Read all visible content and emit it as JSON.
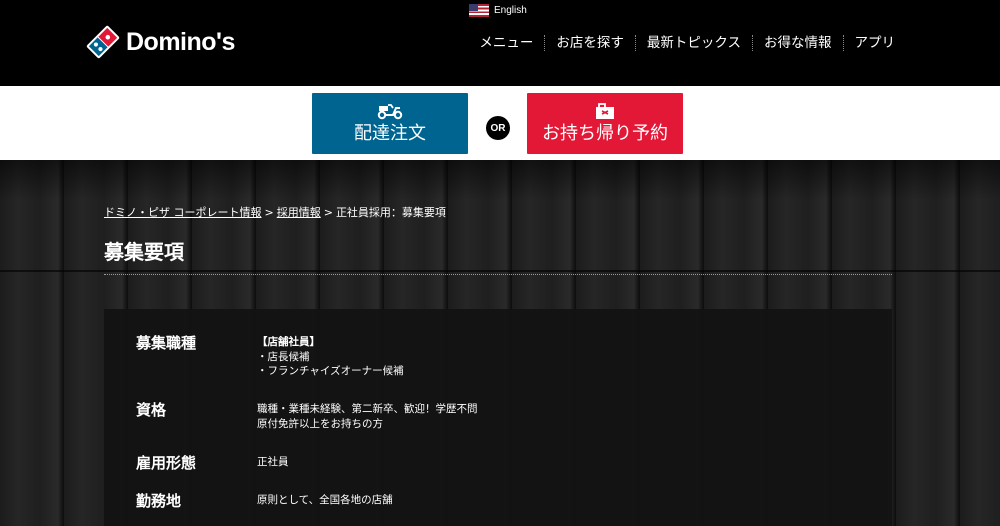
{
  "header": {
    "language": "English",
    "logo_text": "Domino's",
    "nav": [
      "メニュー",
      "お店を探す",
      "最新トピックス",
      "お得な情報",
      "アプリ"
    ]
  },
  "order": {
    "delivery_label": "配達注文",
    "or_label": "OR",
    "carryout_label": "お持ち帰り予約"
  },
  "breadcrumb": {
    "item1": "ドミノ・ピザ コーポレート情報",
    "item2": "採用情報",
    "current": "正社員採用：募集要項",
    "separator": ">"
  },
  "page": {
    "title": "募集要項"
  },
  "details": {
    "rows": [
      {
        "label": "募集職種",
        "lines": [
          "【店舗社員】",
          "・店長候補",
          "・フランチャイズオーナー候補"
        ]
      },
      {
        "label": "資格",
        "lines": [
          "職種・業種未経験、第二新卒、歓迎！学歴不問",
          "原付免許以上をお持ちの方"
        ]
      },
      {
        "label": "雇用形態",
        "lines": [
          "正社員"
        ]
      },
      {
        "label": "勤務地",
        "lines": [
          "原則として、全国各地の店舗"
        ]
      }
    ]
  },
  "colors": {
    "delivery_blue": "#006491",
    "carryout_red": "#e31837",
    "brand_black": "#000000"
  }
}
